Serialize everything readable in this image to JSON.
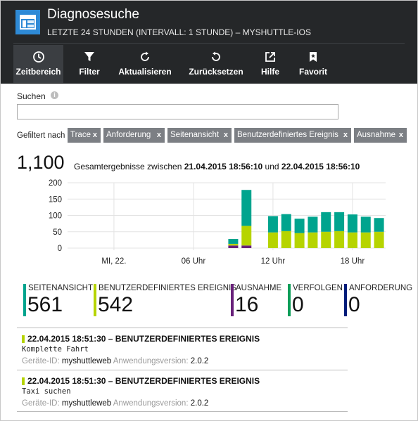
{
  "header": {
    "title": "Diagnosesuche",
    "subtitle": "LETZTE 24 STUNDEN (INTERVALL: 1 STUNDE) – MYSHUTTLE-IOS",
    "app_icon": "dashboard-icon"
  },
  "toolbar": {
    "items": [
      {
        "label": "Zeitbereich",
        "icon": "clock-icon",
        "active": true
      },
      {
        "label": "Filter",
        "icon": "funnel-icon"
      },
      {
        "label": "Aktualisieren",
        "icon": "refresh-icon"
      },
      {
        "label": "Zurücksetzen",
        "icon": "undo-icon"
      },
      {
        "label": "Hilfe",
        "icon": "external-link-icon"
      },
      {
        "label": "Favorit",
        "icon": "bookmark-icon"
      }
    ]
  },
  "search": {
    "label": "Suchen",
    "info_icon": "info-icon",
    "value": "",
    "placeholder": ""
  },
  "filters": {
    "label": "Gefiltert nach",
    "remove_symbol": "x",
    "chips": [
      "Trace",
      "Anforderung",
      "Seitenansicht",
      "Benutzerdefiniertes Ereignis",
      "Ausnahme"
    ]
  },
  "summary": {
    "total": "1,100",
    "prefix": "Gesamtergebnisse zwischen",
    "start": "21.04.2015 18:56:10",
    "connector": "und",
    "end": "22.04.2015 18:56:10"
  },
  "chart_data": {
    "type": "bar",
    "stacked": true,
    "ylim": [
      0,
      200
    ],
    "yticks": [
      "200",
      "150",
      "100",
      "50",
      "0"
    ],
    "xticks": [
      "MI, 22.",
      "06 Uhr",
      "12 Uhr",
      "18 Uhr"
    ],
    "grid": true,
    "x_slots": 24,
    "xtick_slots": [
      3.5,
      9.5,
      15.5,
      21.5
    ],
    "series": [
      {
        "key": "ausnahme",
        "color": "#68217a",
        "values": [
          0,
          0,
          0,
          0,
          0,
          0,
          0,
          0,
          0,
          0,
          0,
          0,
          8,
          8,
          0,
          0,
          0,
          0,
          0,
          0,
          0,
          0,
          0,
          0
        ]
      },
      {
        "key": "benutzerdefiniert",
        "color": "#b6d400",
        "values": [
          0,
          0,
          0,
          0,
          0,
          0,
          0,
          0,
          0,
          0,
          0,
          0,
          5,
          60,
          0,
          48,
          52,
          46,
          48,
          50,
          52,
          48,
          48,
          50
        ]
      },
      {
        "key": "seitenansicht",
        "color": "#00a48e",
        "values": [
          0,
          0,
          0,
          0,
          0,
          0,
          0,
          0,
          0,
          0,
          0,
          0,
          15,
          110,
          0,
          50,
          52,
          44,
          48,
          60,
          58,
          55,
          48,
          42
        ]
      }
    ]
  },
  "stats": [
    {
      "label": "SEITENANSICHT",
      "value": "561",
      "color": "#00a48e"
    },
    {
      "label": "BENUTZERDEFINIERTES EREIGNIS",
      "value": "542",
      "color": "#b6d400"
    },
    {
      "label": "AUSNAHME",
      "value": "16",
      "color": "#68217a"
    },
    {
      "label": "VERFOLGEN",
      "value": "0",
      "color": "#0a9d58"
    },
    {
      "label": "ANFORDERUNG",
      "value": "0",
      "color": "#001c7a"
    }
  ],
  "events": [
    {
      "title": "22.04.2015 18:51:30 – BENUTZERDEFINIERTES EREIGNIS",
      "message": "Komplette Fahrt",
      "device_key": "Geräte-ID:",
      "device_val": "myshuttleweb",
      "version_key": "Anwendungsversion:",
      "version_val": "2.0.2"
    },
    {
      "title": "22.04.2015 18:51:30 – BENUTZERDEFINIERTES EREIGNIS",
      "message": "Taxi suchen",
      "device_key": "Geräte-ID:",
      "device_val": "myshuttleweb",
      "version_key": "Anwendungsversion:",
      "version_val": "2.0.2"
    }
  ]
}
